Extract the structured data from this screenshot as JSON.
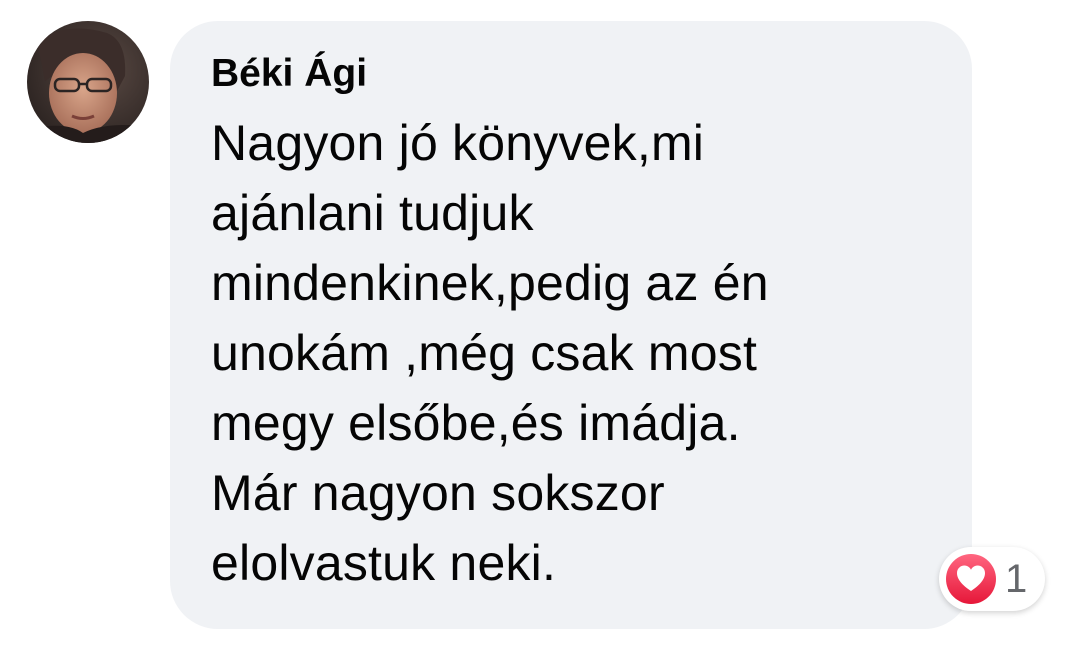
{
  "comment": {
    "author": "Béki Ági",
    "text": "Nagyon jó könyvek,mi\najánlani tudjuk\nmindenkinek,pedig az én\nunokám ,még csak most\nmegy elsőbe,és imádja.\nMár nagyon sokszor\nelolvastuk neki.",
    "avatar": "avatar-photo",
    "reactions": {
      "icon": "love-heart-icon",
      "color": "#f33e58",
      "count": "1"
    }
  },
  "colors": {
    "bubble": "#f0f2f5",
    "text": "#050505",
    "muted": "#65676b"
  }
}
